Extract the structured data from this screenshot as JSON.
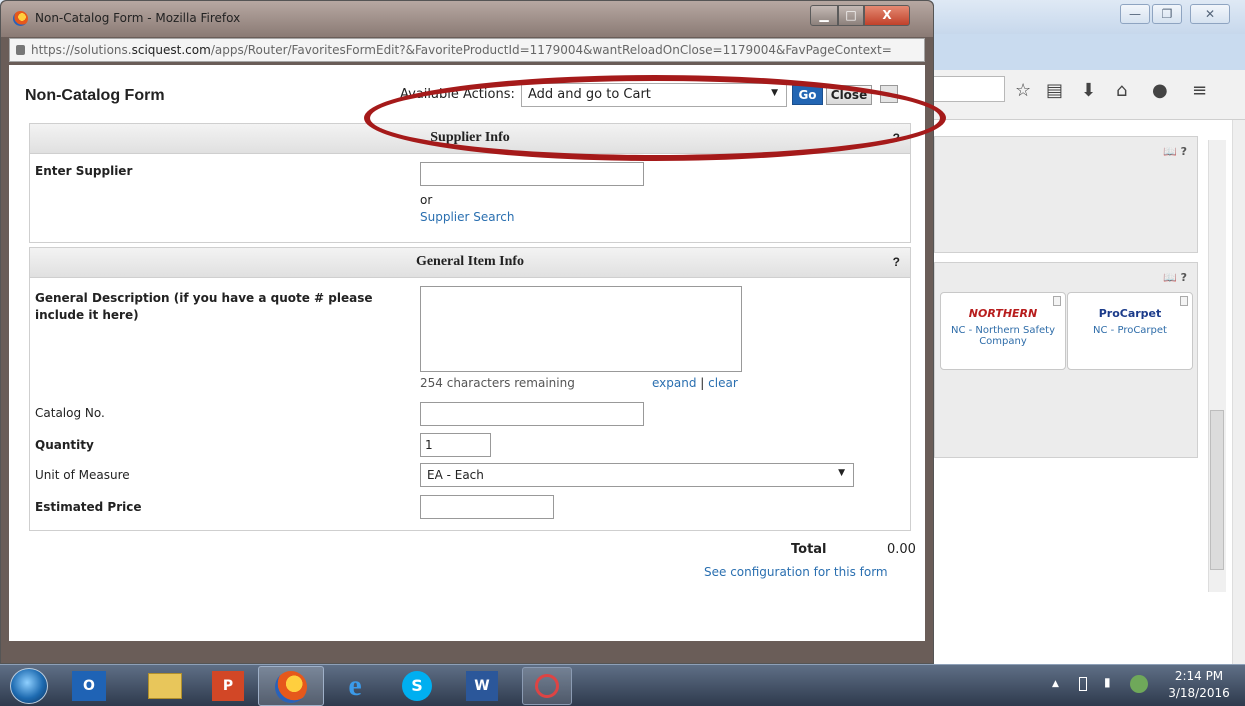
{
  "background": {
    "toolbar_icons": [
      "star-icon",
      "reader-icon",
      "download-icon",
      "home-icon",
      "chat-icon",
      "menu-icon"
    ],
    "winbuttons": [
      "—",
      "❐",
      "✕"
    ],
    "panel_icons": "📖 ?",
    "tiles": [
      {
        "logo": "NORTHERN",
        "label": "NC - Northern Safety Company"
      },
      {
        "logo": "ProCarpet",
        "label": "NC - ProCarpet"
      }
    ]
  },
  "popup": {
    "title": "Non-Catalog Form - Mozilla Firefox",
    "url_prefix": "https://solutions.",
    "url_domain": "sciquest.com",
    "url_suffix": "/apps/Router/FavoritesFormEdit?&FavoriteProductId=1179004&wantReloadOnClose=1179004&FavPageContext=",
    "form_title": "Non-Catalog Form",
    "actions_label": "Available Actions:",
    "actions_value": "Add and go to Cart",
    "go_label": "Go",
    "close_label": "Close",
    "supplier_section": {
      "title": "Supplier Info",
      "help": "?",
      "enter_supplier_label": "Enter Supplier",
      "or_text": "or",
      "supplier_search_link": "Supplier Search"
    },
    "item_section": {
      "title": "General Item Info",
      "help": "?",
      "desc_label": "General Description (if you have a quote # please include it here)",
      "chars_remaining": "254 characters remaining",
      "expand_link": "expand",
      "separator": "|",
      "clear_link": "clear",
      "catalog_label": "Catalog No.",
      "quantity_label": "Quantity",
      "quantity_value": "1",
      "uom_label": "Unit of Measure",
      "uom_value": "EA - Each",
      "price_label": "Estimated Price"
    },
    "total_label": "Total",
    "total_value": "0.00",
    "config_link": "See configuration for this form"
  },
  "taskbar": {
    "apps": [
      "Outlook",
      "File Explorer",
      "PowerPoint",
      "Firefox",
      "Internet Explorer",
      "Skype",
      "Word",
      "Snipping Tool"
    ],
    "time": "2:14 PM",
    "date": "3/18/2016"
  },
  "colors": {
    "accent": "#2265b3",
    "annotation": "#a51a1a",
    "link": "#2a6fb0"
  }
}
